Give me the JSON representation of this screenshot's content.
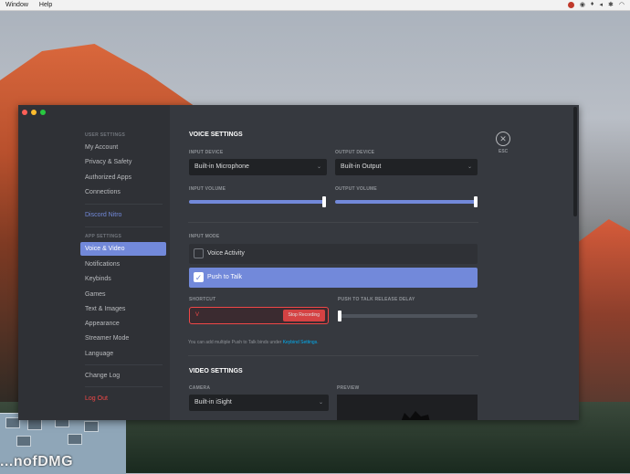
{
  "menubar": {
    "items": [
      "Window",
      "Help"
    ]
  },
  "desktop": {
    "watermark": "...nofDMG"
  },
  "window": {
    "traffic_colors": [
      "#ff5f57",
      "#febc2e",
      "#28c840"
    ],
    "sidebar": {
      "user_settings_label": "USER SETTINGS",
      "user_items": [
        "My Account",
        "Privacy & Safety",
        "Authorized Apps",
        "Connections"
      ],
      "nitro": "Discord Nitro",
      "app_settings_label": "APP SETTINGS",
      "app_items": [
        "Voice & Video",
        "Notifications",
        "Keybinds",
        "Games",
        "Text & Images",
        "Appearance",
        "Streamer Mode",
        "Language"
      ],
      "active_item": "Voice & Video",
      "changelog": "Change Log",
      "logout": "Log Out"
    },
    "voice": {
      "title": "VOICE SETTINGS",
      "input_device_label": "INPUT DEVICE",
      "input_device_value": "Built-in Microphone",
      "output_device_label": "OUTPUT DEVICE",
      "output_device_value": "Built-in Output",
      "input_volume_label": "INPUT VOLUME",
      "input_volume_level": 1.0,
      "output_volume_label": "OUTPUT VOLUME",
      "output_volume_level": 1.0,
      "input_mode_label": "INPUT MODE",
      "mode_voice_activity": "Voice Activity",
      "mode_push_to_talk": "Push to Talk",
      "selected_mode": "Push to Talk",
      "shortcut_label": "SHORTCUT",
      "shortcut_value": "V",
      "stop_recording": "Stop Recording",
      "release_delay_label": "PUSH TO TALK RELEASE DELAY",
      "release_delay_level": 0.0,
      "help_text": "You can add multiple Push to Talk binds under",
      "help_link": "Keybind Settings."
    },
    "video": {
      "title": "VIDEO SETTINGS",
      "camera_label": "CAMERA",
      "camera_value": "Built-in iSight",
      "preview_label": "PREVIEW"
    },
    "close": {
      "label": "ESC",
      "glyph": "✕"
    }
  },
  "colors": {
    "accent": "#7289da",
    "danger": "#f04747",
    "link": "#00b0f4"
  }
}
